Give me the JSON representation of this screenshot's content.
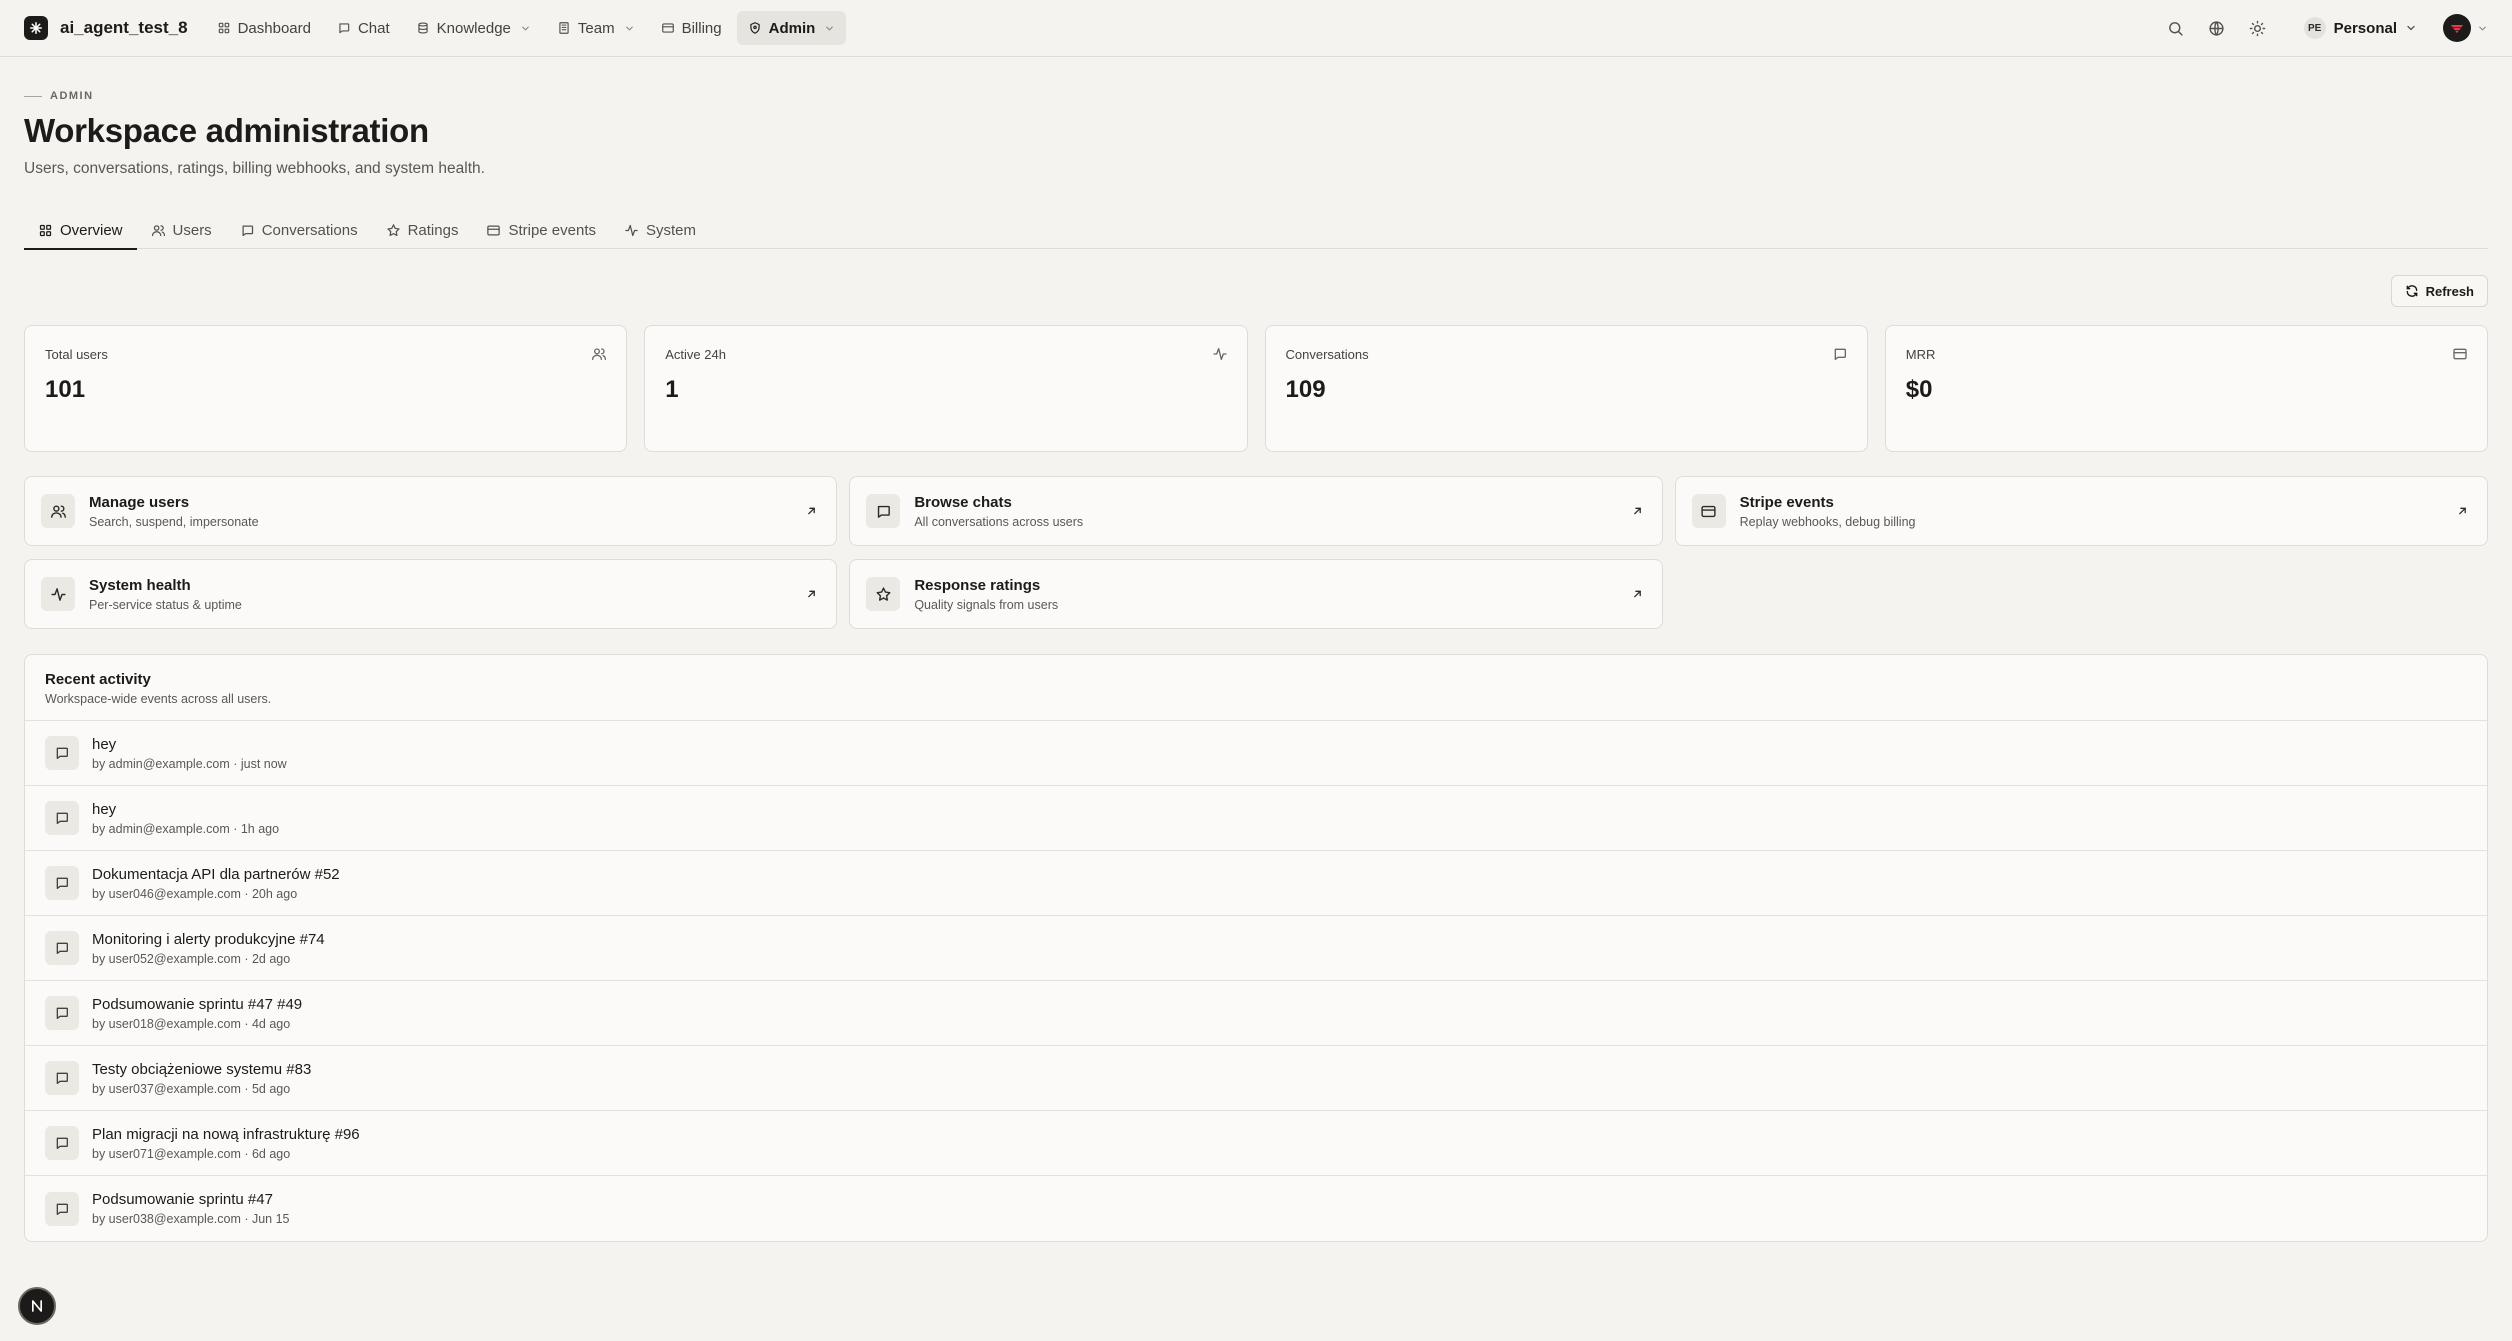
{
  "nav": {
    "brand": "ai_agent_test_8",
    "items": [
      {
        "label": "Dashboard",
        "icon": "grid-icon",
        "dropdown": false,
        "active": false
      },
      {
        "label": "Chat",
        "icon": "message-icon",
        "dropdown": false,
        "active": false
      },
      {
        "label": "Knowledge",
        "icon": "database-icon",
        "dropdown": true,
        "active": false
      },
      {
        "label": "Team",
        "icon": "building-icon",
        "dropdown": true,
        "active": false
      },
      {
        "label": "Billing",
        "icon": "card-icon",
        "dropdown": false,
        "active": false
      },
      {
        "label": "Admin",
        "icon": "shield-icon",
        "dropdown": true,
        "active": true
      }
    ],
    "workspace_badge": "PE",
    "workspace_name": "Personal"
  },
  "header": {
    "eyebrow": "ADMIN",
    "title": "Workspace administration",
    "subtitle": "Users, conversations, ratings, billing webhooks, and system health."
  },
  "tabs": [
    {
      "label": "Overview",
      "icon": "grid-icon",
      "active": true
    },
    {
      "label": "Users",
      "icon": "users-icon",
      "active": false
    },
    {
      "label": "Conversations",
      "icon": "message-icon",
      "active": false
    },
    {
      "label": "Ratings",
      "icon": "star-icon",
      "active": false
    },
    {
      "label": "Stripe events",
      "icon": "card-icon",
      "active": false
    },
    {
      "label": "System",
      "icon": "activity-icon",
      "active": false
    }
  ],
  "toolbar": {
    "refresh_label": "Refresh"
  },
  "stats": [
    {
      "label": "Total users",
      "value": "101",
      "icon": "users-icon"
    },
    {
      "label": "Active 24h",
      "value": "1",
      "icon": "activity-icon"
    },
    {
      "label": "Conversations",
      "value": "109",
      "icon": "message-icon"
    },
    {
      "label": "MRR",
      "value": "$0",
      "icon": "card-icon"
    }
  ],
  "links": [
    {
      "title": "Manage users",
      "desc": "Search, suspend, impersonate",
      "icon": "users-icon"
    },
    {
      "title": "Browse chats",
      "desc": "All conversations across users",
      "icon": "message-icon"
    },
    {
      "title": "Stripe events",
      "desc": "Replay webhooks, debug billing",
      "icon": "card-icon"
    },
    {
      "title": "System health",
      "desc": "Per-service status & uptime",
      "icon": "activity-icon"
    },
    {
      "title": "Response ratings",
      "desc": "Quality signals from users",
      "icon": "star-icon"
    }
  ],
  "activity": {
    "title": "Recent activity",
    "subtitle": "Workspace-wide events across all users.",
    "items": [
      {
        "title": "hey",
        "meta": "by admin@example.com · just now"
      },
      {
        "title": "hey",
        "meta": "by admin@example.com · 1h ago"
      },
      {
        "title": "Dokumentacja API dla partnerów #52",
        "meta": "by user046@example.com · 20h ago"
      },
      {
        "title": "Monitoring i alerty produkcyjne #74",
        "meta": "by user052@example.com · 2d ago"
      },
      {
        "title": "Podsumowanie sprintu #47 #49",
        "meta": "by user018@example.com · 4d ago"
      },
      {
        "title": "Testy obciążeniowe systemu #83",
        "meta": "by user037@example.com · 5d ago"
      },
      {
        "title": "Plan migracji na nową infrastrukturę #96",
        "meta": "by user071@example.com · 6d ago"
      },
      {
        "title": "Podsumowanie sprintu #47",
        "meta": "by user038@example.com · Jun 15"
      }
    ]
  },
  "fab_label": "N"
}
